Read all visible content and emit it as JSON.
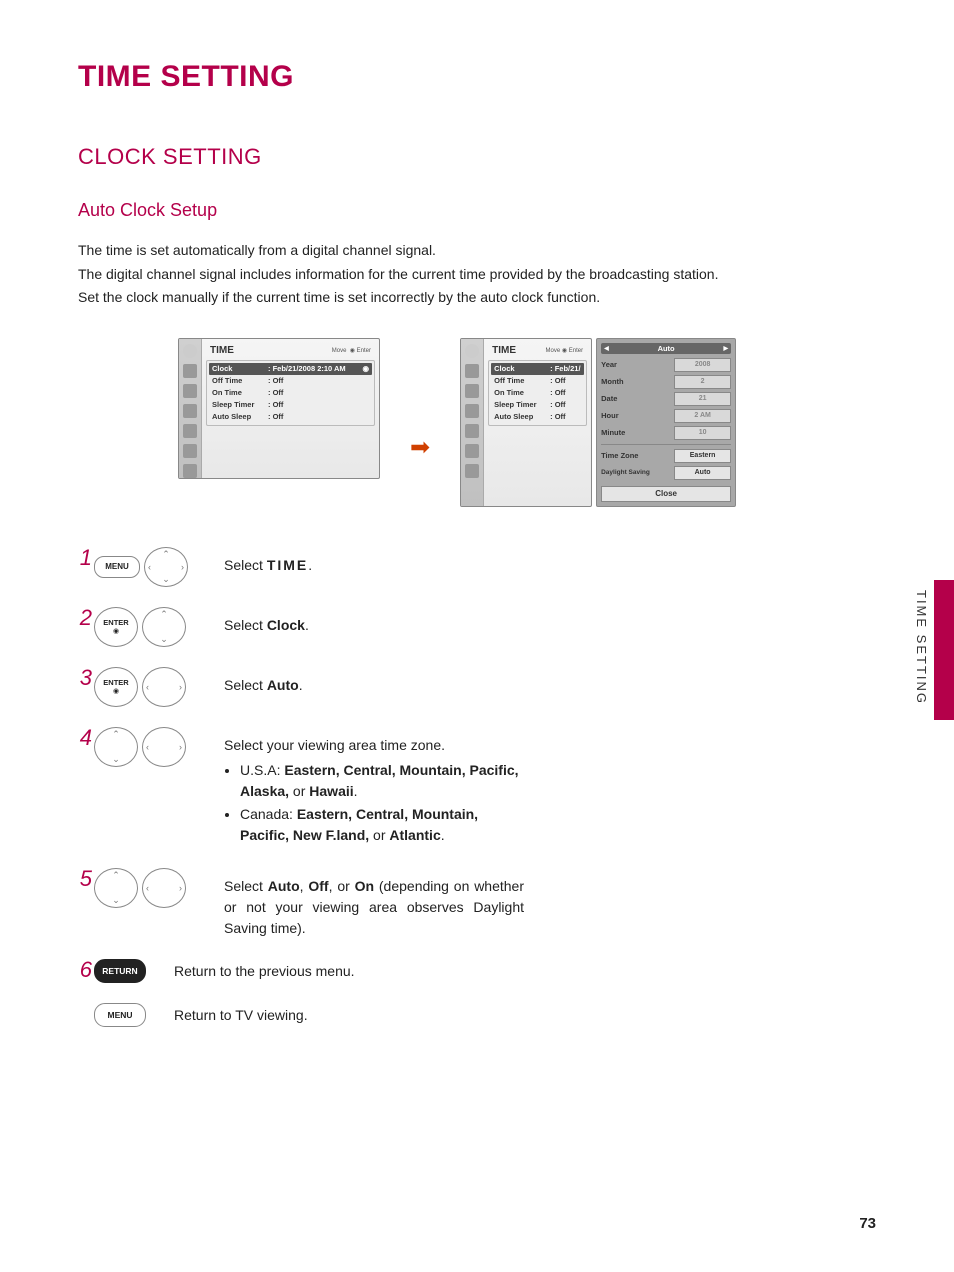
{
  "title": "TIME SETTING",
  "section": "CLOCK SETTING",
  "subsection": "Auto Clock Setup",
  "intro": {
    "p1": "The time is set automatically from a digital channel signal.",
    "p2": "The digital channel signal includes information for the current time provided by the broadcasting station.",
    "p3": "Set the clock manually if the current time is set incorrectly by the auto clock function."
  },
  "screen1": {
    "panel_title": "TIME",
    "move_label": "Move",
    "enter_label": "Enter",
    "rows": {
      "clock_k": "Clock",
      "clock_v": ": Feb/21/2008 2:10 AM",
      "off_k": "Off Time",
      "off_v": ": Off",
      "on_k": "On Time",
      "on_v": ": Off",
      "sleep_k": "Sleep Timer",
      "sleep_v": ": Off",
      "auto_k": "Auto Sleep",
      "auto_v": ": Off"
    }
  },
  "screen2": {
    "panel_title": "TIME",
    "move_label": "Move",
    "enter_label": "Enter",
    "rows": {
      "clock_k": "Clock",
      "clock_v": ": Feb/21/",
      "off_k": "Off Time",
      "off_v": ": Off",
      "on_k": "On Time",
      "on_v": ": Off",
      "sleep_k": "Sleep Timer",
      "sleep_v": ": Off",
      "auto_k": "Auto Sleep",
      "auto_v": ": Off"
    },
    "side": {
      "top": "Auto",
      "year_l": "Year",
      "year_v": "2008",
      "month_l": "Month",
      "month_v": "2",
      "date_l": "Date",
      "date_v": "21",
      "hour_l": "Hour",
      "hour_v": "2 AM",
      "minute_l": "Minute",
      "minute_v": "10",
      "tz_l": "Time Zone",
      "tz_v": "Eastern",
      "ds_l": "Daylight Saving",
      "ds_v": "Auto",
      "close": "Close"
    }
  },
  "buttons": {
    "menu": "MENU",
    "enter": "ENTER",
    "return": "RETURN"
  },
  "steps": {
    "1": {
      "pre": "Select ",
      "bold": "TIME",
      "post": "."
    },
    "2": {
      "pre": "Select ",
      "bold": "Clock",
      "post": "."
    },
    "3": {
      "pre": "Select ",
      "bold": "Auto",
      "post": "."
    },
    "4": {
      "line1": "Select your viewing area time zone.",
      "usa_pre": "U.S.A: ",
      "usa_bold": "Eastern, Central, Mountain, Pacific, Alaska,",
      "usa_post": " or ",
      "usa_last": "Hawaii",
      "can_pre": "Canada: ",
      "can_bold": "Eastern, Central, Mountain, Pacific, New F.land,",
      "can_post": " or ",
      "can_last": "Atlantic"
    },
    "5": {
      "text_pre": "Select ",
      "b1": "Auto",
      "sep1": ", ",
      "b2": "Off",
      "sep2": ", or ",
      "b3": "On",
      "text_post": " (depending on whether or not your viewing area observes Daylight Saving time)."
    },
    "6": {
      "text": "Return to the previous menu."
    },
    "7": {
      "text": "Return to TV viewing."
    }
  },
  "side_label": "TIME SETTING",
  "page_number": "73"
}
